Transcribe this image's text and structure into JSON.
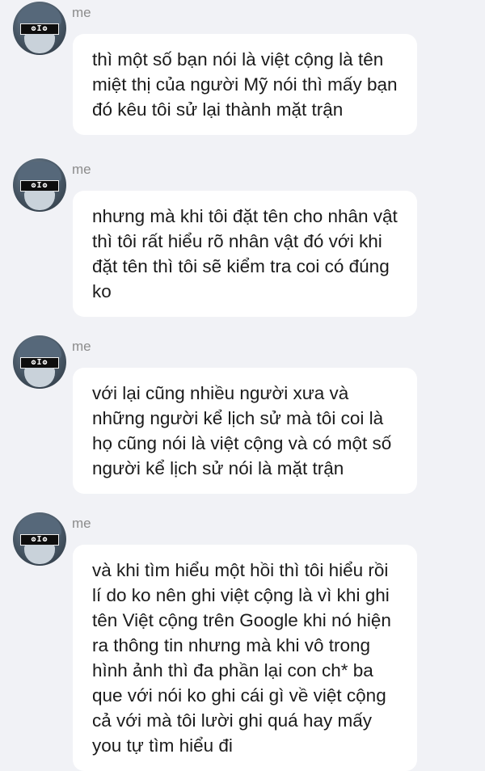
{
  "messages": [
    {
      "sender": "me",
      "avatar_text": "ʘIʘ",
      "text": "thì một số bạn nói là việt cộng là tên miệt thị của người Mỹ nói thì mấy bạn đó kêu tôi sử lại thành mặt trận"
    },
    {
      "sender": "me",
      "avatar_text": "ʘIʘ",
      "text": "nhưng mà khi tôi đặt tên cho nhân vật thì tôi rất hiểu rõ nhân vật đó với khi đặt tên thì tôi sẽ kiểm tra coi có đúng ko"
    },
    {
      "sender": "me",
      "avatar_text": "ʘIʘ",
      "text": "với lại cũng nhiều người xưa và những người kể lịch sử mà tôi coi là họ cũng nói là việt cộng và có một số người kể lịch sử nói là mặt trận"
    },
    {
      "sender": "me",
      "avatar_text": "ʘIʘ",
      "text": "và khi tìm hiểu một hồi thì tôi hiểu rồi lí do ko nên ghi việt cộng là vì khi ghi tên Việt cộng trên Google khi nó hiện ra thông tin nhưng mà khi vô trong hình ảnh thì đa phần lại con ch* ba que với nói ko ghi cái gì về việt cộng cả với mà tôi lười ghi quá hay mấy you tự tìm hiểu đi"
    }
  ]
}
